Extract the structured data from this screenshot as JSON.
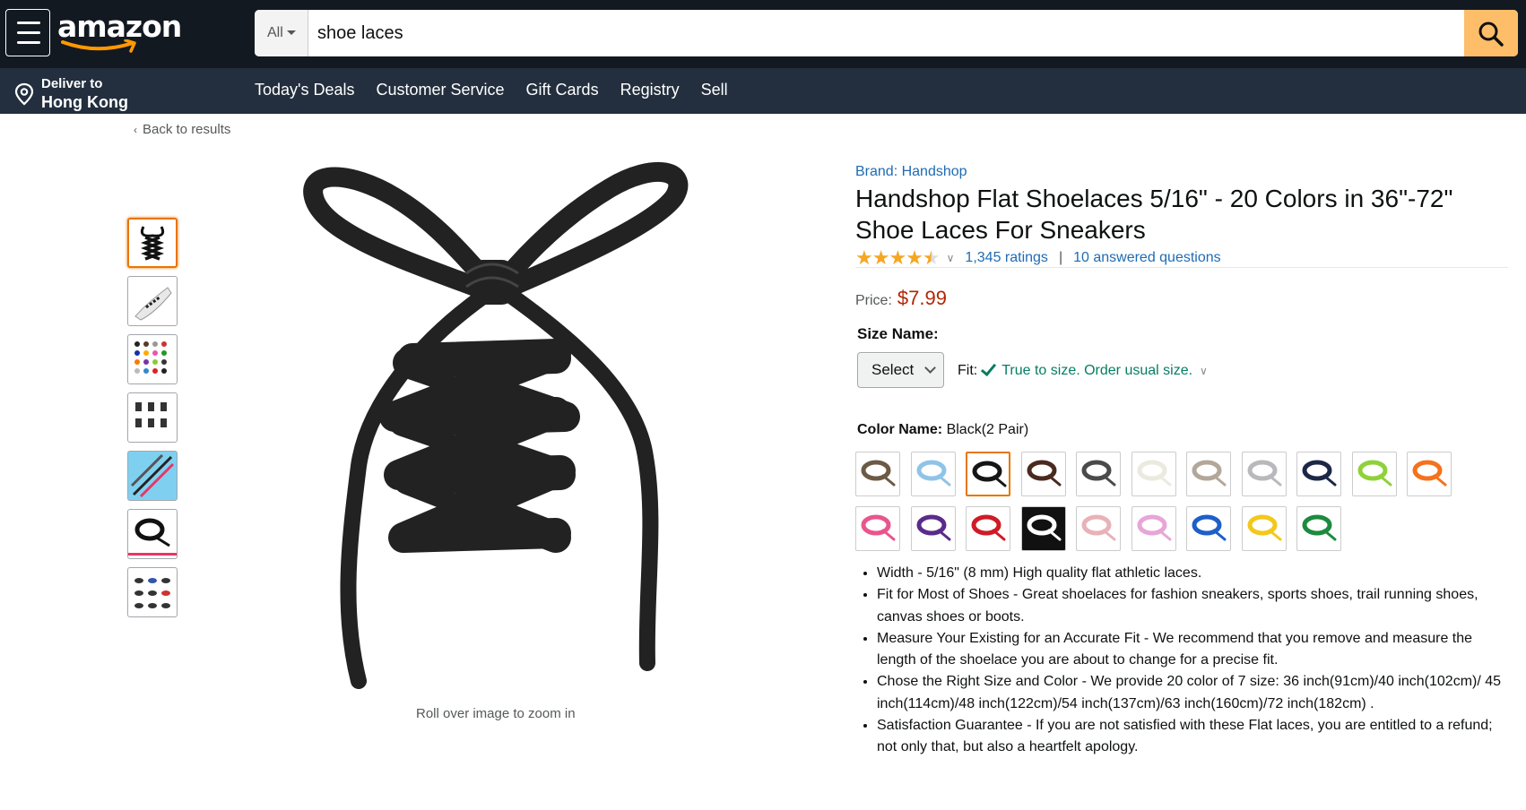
{
  "nav": {
    "logo": "amazon",
    "search_category": "All",
    "search_value": "shoe laces",
    "deliver_line1": "Deliver to",
    "deliver_line2": "Hong Kong",
    "links": [
      "Today's Deals",
      "Customer Service",
      "Gift Cards",
      "Registry",
      "Sell"
    ]
  },
  "back_link": "Back to results",
  "gallery": {
    "thumbnail_count": 7,
    "selected_index": 0,
    "zoom_hint": "Roll over image to zoom in"
  },
  "product": {
    "brand": "Brand: Handshop",
    "title": "Handshop Flat Shoelaces 5/16\" - 20 Colors in 36\"-72\" Shoe Laces For Sneakers",
    "rating_stars": 4.5,
    "ratings": "1,345 ratings",
    "separator": "|",
    "answered": "10 answered questions",
    "price_label": "Price:",
    "price": "$7.99",
    "size_label": "Size Name:",
    "size_select": "Select",
    "fit_label": "Fit:",
    "fit_value": "True to size. Order usual size.",
    "color_label": "Color Name:",
    "color_value": "Black(2 Pair)",
    "selected_color_index": 2,
    "swatch_colors": [
      "#6b5a45",
      "#8fc4e8",
      "#151515",
      "#4a2a1e",
      "#4a4a4a",
      "#ece9df",
      "#b3a79a",
      "#b9b9bd",
      "#1c2747",
      "#8fd13a",
      "#f5721d",
      "#e9558d",
      "#5a2b8a",
      "#cf1b26",
      "#ffffff",
      "#e8b2b8",
      "#e7a6d6",
      "#1e5fc8",
      "#f2c81c",
      "#1d8a3e"
    ],
    "bullets": [
      "Width - 5/16\" (8 mm) High quality flat athletic laces.",
      "Fit for Most of Shoes - Great shoelaces for fashion sneakers, sports shoes, trail running shoes, canvas shoes or boots.",
      "Measure Your Existing for an Accurate Fit - We recommend that you remove and measure the length of the shoelace you are about to change for a precise fit.",
      "Chose the Right Size and Color - We provide 20 color of 7 size: 36 inch(91cm)/40 inch(102cm)/ 45 inch(114cm)/48 inch(122cm)/54 inch(137cm)/63 inch(160cm)/72 inch(182cm) .",
      "Satisfaction Guarantee - If you are not satisfied with these Flat laces, you are entitled to a refund; not only that, but also a heartfelt apology."
    ]
  },
  "colors": {
    "nav_bg": "#131921",
    "subnav_bg": "#232f3e",
    "search_button": "#febd69",
    "link": "#1f6bb3",
    "price": "#b12704",
    "selected_outline": "#e77600",
    "fit_ok": "#067d62"
  }
}
